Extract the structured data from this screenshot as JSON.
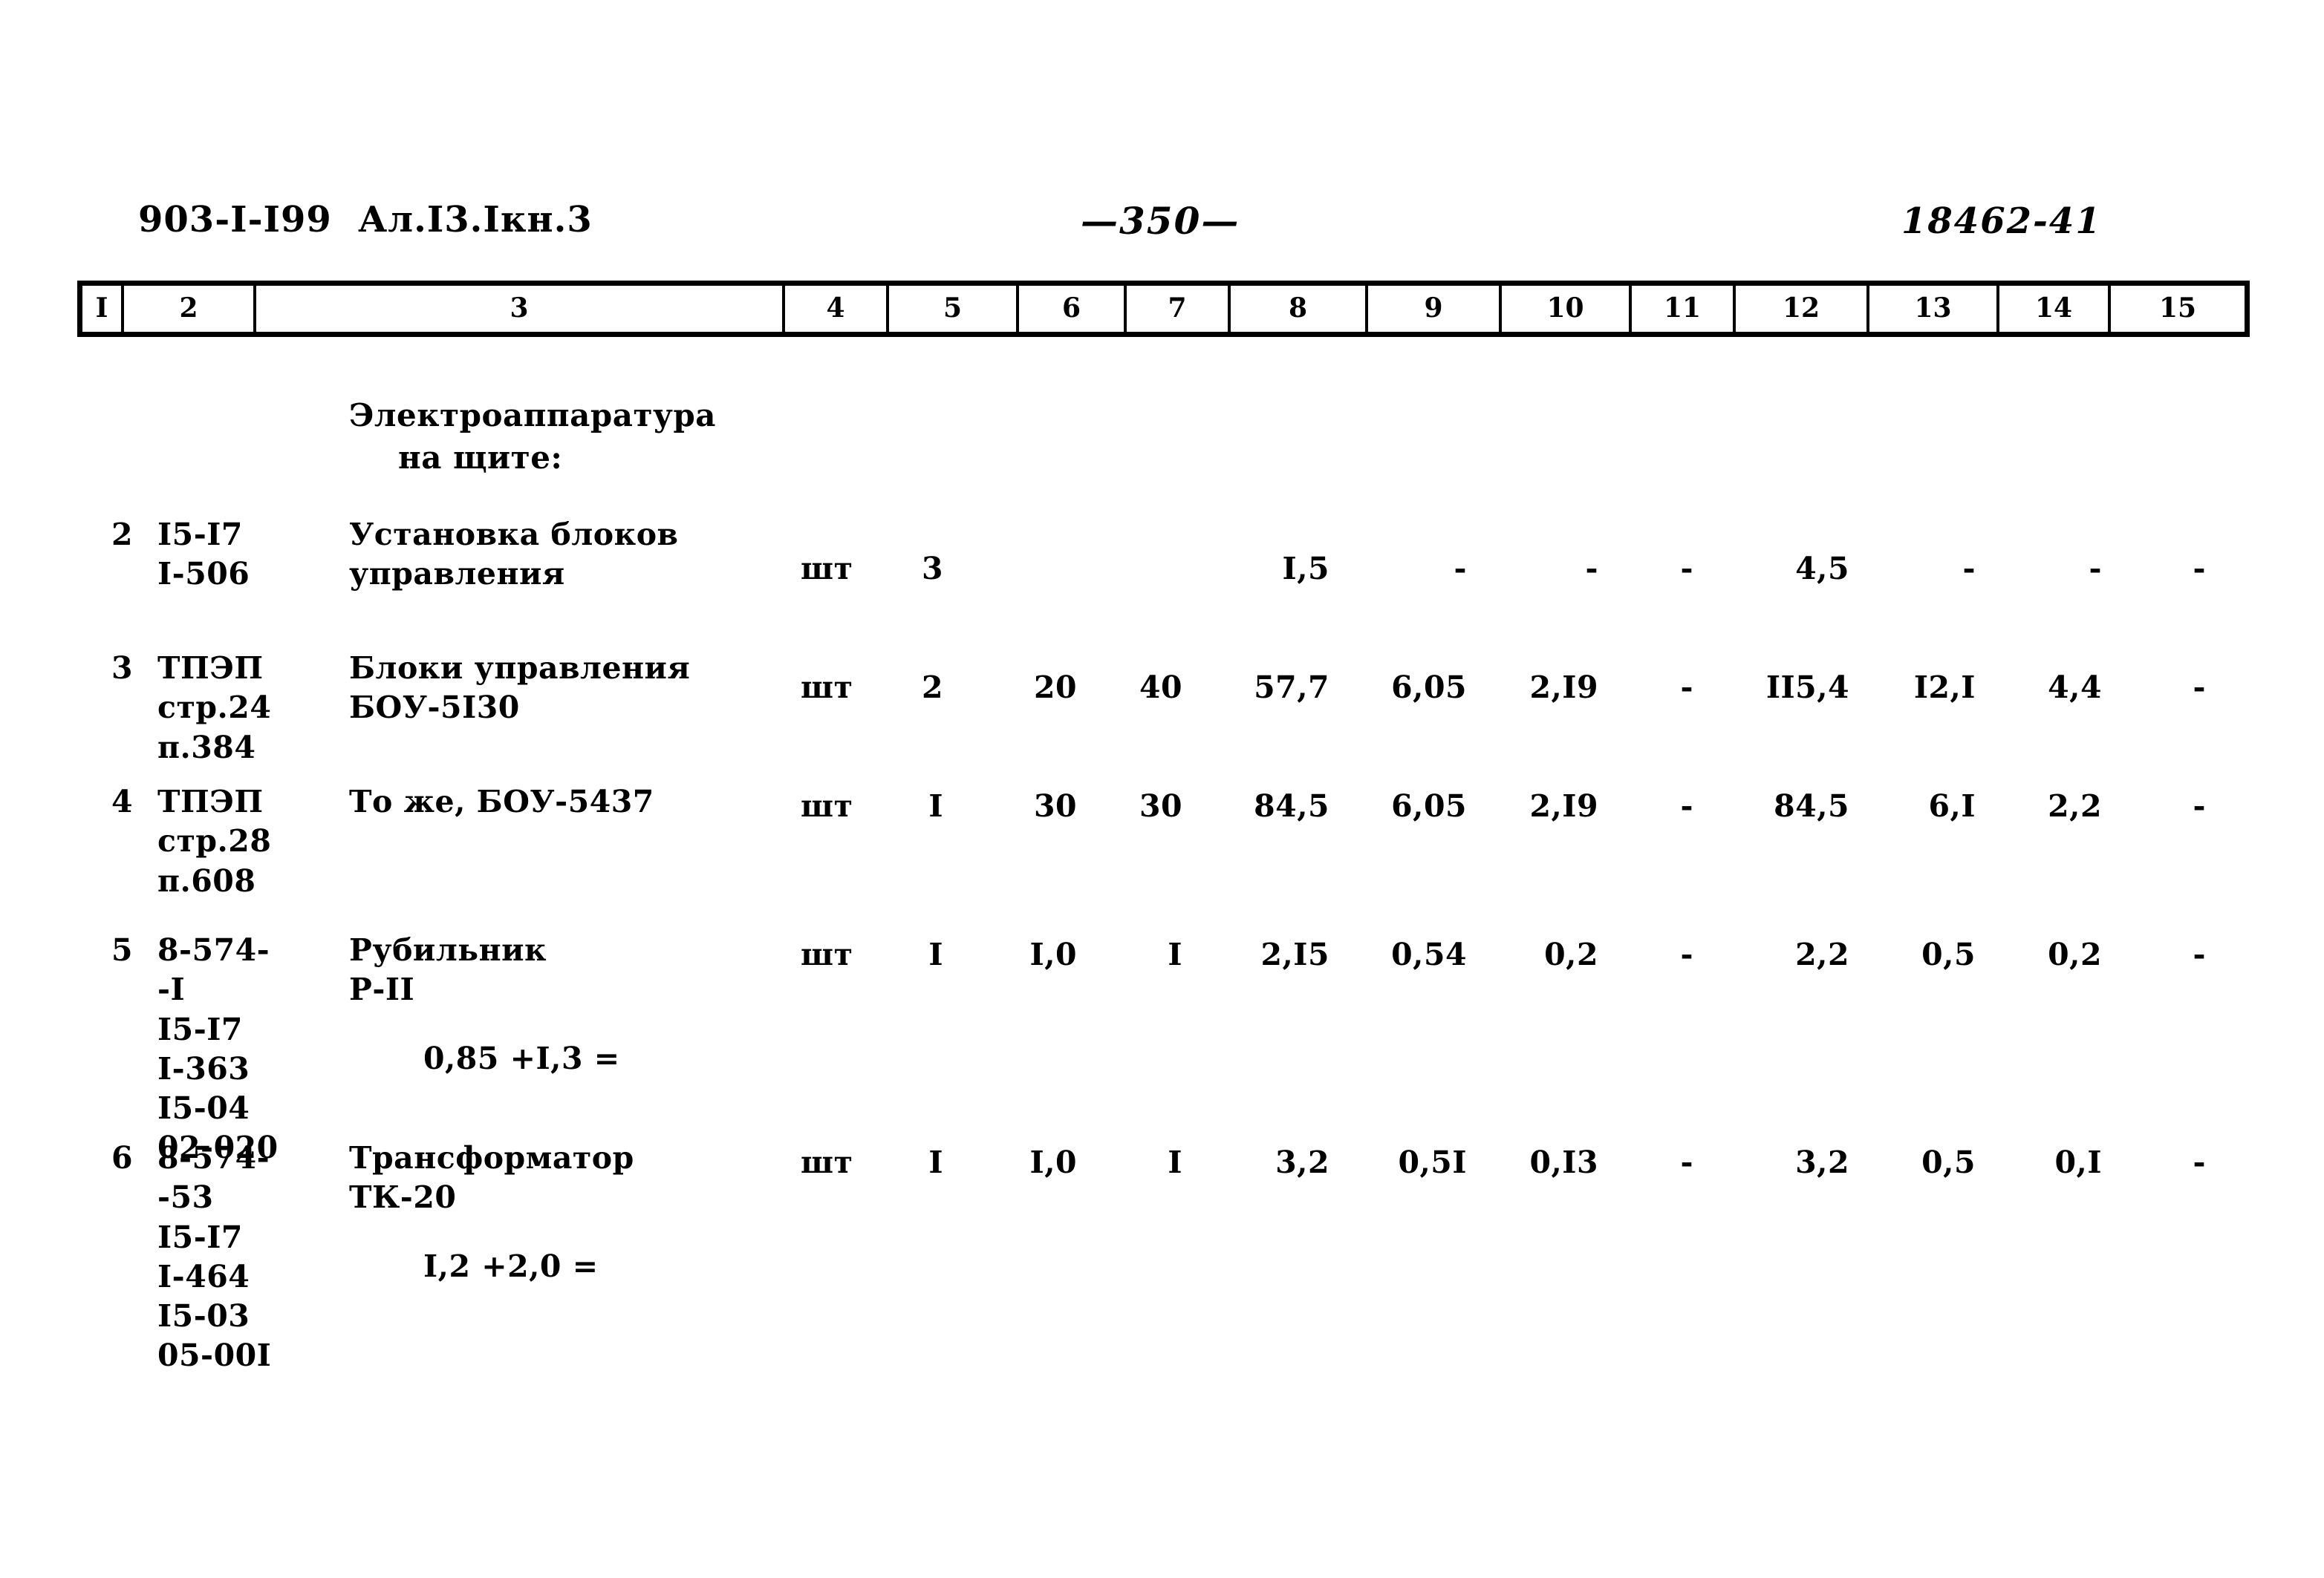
{
  "header": {
    "doc_code": "903-I-I99  Ал.I3.Iкн.3",
    "page_number": "—350—",
    "stamp_number": "18462-41"
  },
  "table": {
    "column_headers": [
      "I",
      "2",
      "3",
      "4",
      "5",
      "6",
      "7",
      "8",
      "9",
      "10",
      "11",
      "12",
      "13",
      "14",
      "15"
    ],
    "section_heading": {
      "line1": "Электроаппаратура",
      "line2": "на щите:"
    },
    "rows": [
      {
        "num": "2",
        "code": "I5-I7\nI-506",
        "name": "Установка блоков\nуправления",
        "unit": "шт",
        "c5": "3",
        "c6": "",
        "c7": "",
        "c8": "I,5",
        "c9": "-",
        "c10": "-",
        "c11": "-",
        "c12": "4,5",
        "c13": "-",
        "c14": "-",
        "c15": "-",
        "note": ""
      },
      {
        "num": "3",
        "code": "ТПЭП\nстр.24\nп.384",
        "name": "Блоки управления\nБОУ-5I30",
        "unit": "шт",
        "c5": "2",
        "c6": "20",
        "c7": "40",
        "c8": "57,7",
        "c9": "6,05",
        "c10": "2,I9",
        "c11": "-",
        "c12": "II5,4",
        "c13": "I2,I",
        "c14": "4,4",
        "c15": "-",
        "note": ""
      },
      {
        "num": "4",
        "code": "ТПЭП\nстр.28\nп.608",
        "name": "То же, БОУ-5437",
        "unit": "шт",
        "c5": "I",
        "c6": "30",
        "c7": "30",
        "c8": "84,5",
        "c9": "6,05",
        "c10": "2,I9",
        "c11": "-",
        "c12": "84,5",
        "c13": "6,I",
        "c14": "2,2",
        "c15": "-",
        "note": ""
      },
      {
        "num": "5",
        "code": "8-574-\n-I\nI5-I7\nI-363\nI5-04\n02-020",
        "name": "Рубильник\nР-II",
        "unit": "шт",
        "c5": "I",
        "c6": "I,0",
        "c7": "I",
        "c8": "2,I5",
        "c9": "0,54",
        "c10": "0,2",
        "c11": "-",
        "c12": "2,2",
        "c13": "0,5",
        "c14": "0,2",
        "c15": "-",
        "note": "0,85 +I,3 ="
      },
      {
        "num": "6",
        "code": "8-574-\n-53\nI5-I7\nI-464\nI5-03\n05-00I",
        "name": "Трансформатор\nТК-20",
        "unit": "шт",
        "c5": "I",
        "c6": "I,0",
        "c7": "I",
        "c8": "3,2",
        "c9": "0,5I",
        "c10": "0,I3",
        "c11": "-",
        "c12": "3,2",
        "c13": "0,5",
        "c14": "0,I",
        "c15": "-",
        "note": "I,2 +2,0 ="
      }
    ]
  }
}
